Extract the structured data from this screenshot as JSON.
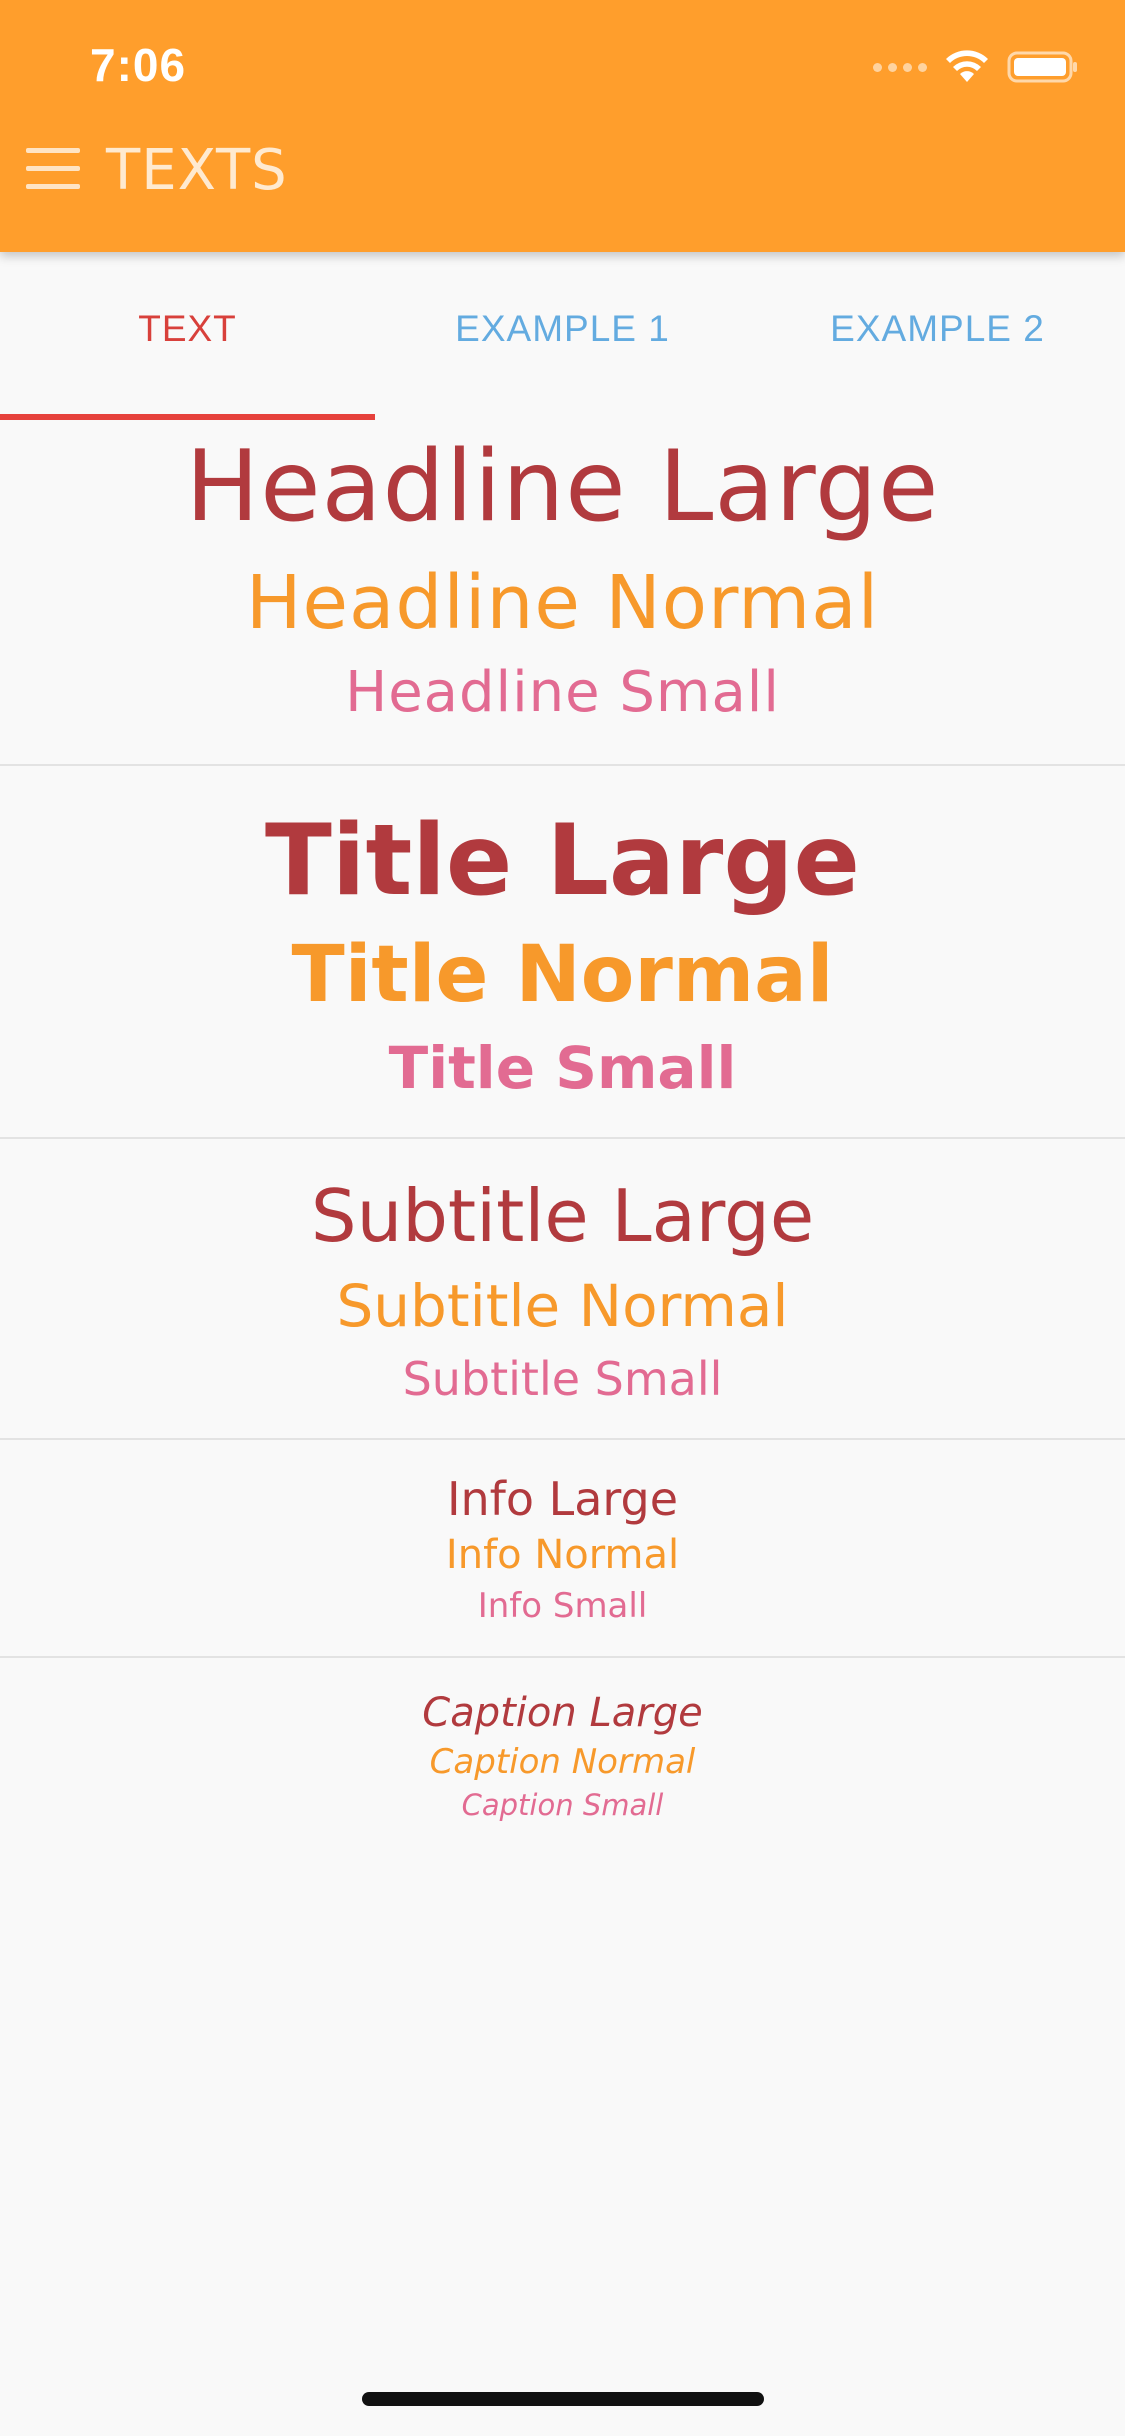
{
  "status_bar": {
    "time": "7:06",
    "icons": [
      "cellular-icon",
      "wifi-icon",
      "battery-icon"
    ]
  },
  "app_bar": {
    "title": "TEXTS",
    "menu_icon": "hamburger-menu-icon"
  },
  "tabs": [
    {
      "label": "TEXT",
      "active": true
    },
    {
      "label": "EXAMPLE 1",
      "active": false
    },
    {
      "label": "EXAMPLE 2",
      "active": false
    }
  ],
  "colors": {
    "app_bar": "#ff9e2c",
    "large": "#b13a3e",
    "normal": "#f7992b",
    "small": "#e26b92",
    "tab_active": "#d8403b",
    "tab_inactive": "#63abe0"
  },
  "sections": {
    "headline": {
      "large": "Headline Large",
      "normal": "Headline Normal",
      "small": "Headline Small"
    },
    "title": {
      "large": "Title Large",
      "normal": "Title Normal",
      "small": "Title Small"
    },
    "subtitle": {
      "large": "Subtitle Large",
      "normal": "Subtitle Normal",
      "small": "Subtitle Small"
    },
    "info": {
      "large": "Info Large",
      "normal": "Info Normal",
      "small": "Info Small"
    },
    "caption": {
      "large": "Caption Large",
      "normal": "Caption Normal",
      "small": "Caption Small"
    }
  }
}
